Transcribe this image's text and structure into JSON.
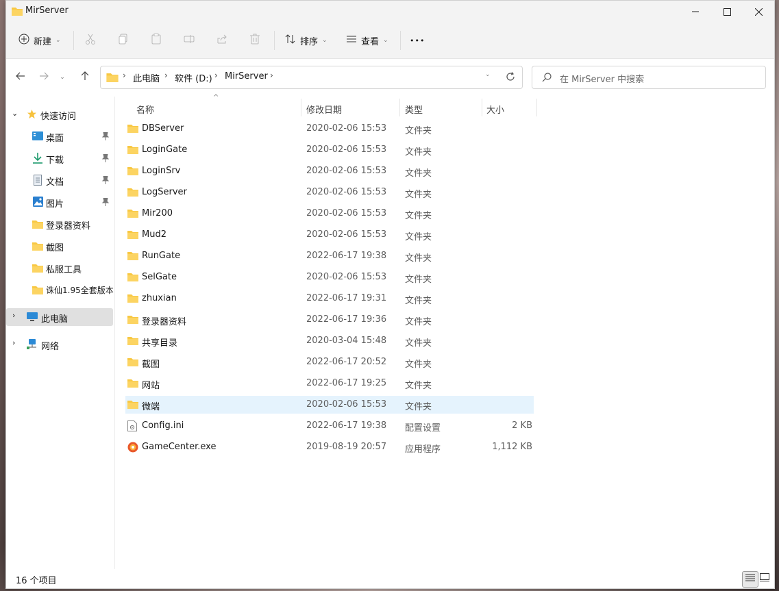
{
  "window": {
    "title": "MirServer"
  },
  "toolbar": {
    "new_label": "新建",
    "sort_label": "排序",
    "view_label": "查看",
    "more_label": "•••"
  },
  "address": {
    "crumbs": [
      "此电脑",
      "软件 (D:)",
      "MirServer"
    ],
    "separator": "›"
  },
  "search": {
    "placeholder": "在 MirServer 中搜索"
  },
  "sidebar": {
    "quick_access": "快速访问",
    "items": [
      {
        "label": "桌面",
        "icon": "desktop-icon",
        "pinned": true
      },
      {
        "label": "下载",
        "icon": "download-icon",
        "pinned": true
      },
      {
        "label": "文档",
        "icon": "document-icon",
        "pinned": true
      },
      {
        "label": "图片",
        "icon": "picture-icon",
        "pinned": true
      },
      {
        "label": "登录器资料",
        "icon": "folder-icon",
        "pinned": false
      },
      {
        "label": "截图",
        "icon": "folder-icon",
        "pinned": false
      },
      {
        "label": "私服工具",
        "icon": "folder-icon",
        "pinned": false
      },
      {
        "label": "诛仙1.95全套版本",
        "icon": "folder-icon",
        "pinned": false
      }
    ],
    "this_pc": "此电脑",
    "network": "网络"
  },
  "columns": {
    "name": "名称",
    "modified": "修改日期",
    "type": "类型",
    "size": "大小"
  },
  "files": [
    {
      "name": "DBServer",
      "date": "2020-02-06 15:53",
      "type": "文件夹",
      "size": "",
      "kind": "folder"
    },
    {
      "name": "LoginGate",
      "date": "2020-02-06 15:53",
      "type": "文件夹",
      "size": "",
      "kind": "folder"
    },
    {
      "name": "LoginSrv",
      "date": "2020-02-06 15:53",
      "type": "文件夹",
      "size": "",
      "kind": "folder"
    },
    {
      "name": "LogServer",
      "date": "2020-02-06 15:53",
      "type": "文件夹",
      "size": "",
      "kind": "folder"
    },
    {
      "name": "Mir200",
      "date": "2020-02-06 15:53",
      "type": "文件夹",
      "size": "",
      "kind": "folder"
    },
    {
      "name": "Mud2",
      "date": "2020-02-06 15:53",
      "type": "文件夹",
      "size": "",
      "kind": "folder"
    },
    {
      "name": "RunGate",
      "date": "2022-06-17 19:38",
      "type": "文件夹",
      "size": "",
      "kind": "folder"
    },
    {
      "name": "SelGate",
      "date": "2020-02-06 15:53",
      "type": "文件夹",
      "size": "",
      "kind": "folder"
    },
    {
      "name": "zhuxian",
      "date": "2022-06-17 19:31",
      "type": "文件夹",
      "size": "",
      "kind": "folder"
    },
    {
      "name": "登录器资料",
      "date": "2022-06-17 19:36",
      "type": "文件夹",
      "size": "",
      "kind": "folder"
    },
    {
      "name": "共享目录",
      "date": "2020-03-04 15:48",
      "type": "文件夹",
      "size": "",
      "kind": "folder"
    },
    {
      "name": "截图",
      "date": "2022-06-17 20:52",
      "type": "文件夹",
      "size": "",
      "kind": "folder"
    },
    {
      "name": "网站",
      "date": "2022-06-17 19:25",
      "type": "文件夹",
      "size": "",
      "kind": "folder"
    },
    {
      "name": "微端",
      "date": "2020-02-06 15:53",
      "type": "文件夹",
      "size": "",
      "kind": "folder",
      "selected": true
    },
    {
      "name": "Config.ini",
      "date": "2022-06-17 19:38",
      "type": "配置设置",
      "size": "2 KB",
      "kind": "ini"
    },
    {
      "name": "GameCenter.exe",
      "date": "2019-08-19 20:57",
      "type": "应用程序",
      "size": "1,112 KB",
      "kind": "exe"
    }
  ],
  "status": {
    "count": "16 个项目"
  },
  "colors": {
    "folder": "#f8c843",
    "selected_row": "#e5f3fd",
    "accent": "#0067c0"
  }
}
